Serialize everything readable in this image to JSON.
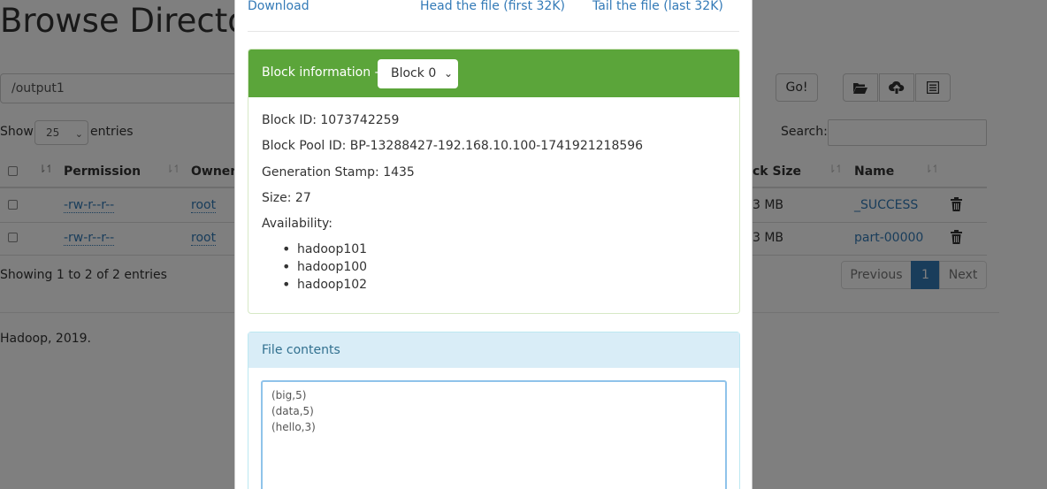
{
  "page": {
    "title": "Browse Directory",
    "path_value": "/output1",
    "go_label": "Go!",
    "show_label": "Show",
    "entries_per_page": "25",
    "entries_label": "entries",
    "search_label": "Search:",
    "columns": [
      "Permission",
      "Owner",
      "ck Size",
      "Name"
    ],
    "rows": [
      {
        "permission": "-rw-r--r--",
        "owner": "root",
        "block_size": "3 MB",
        "name": "_SUCCESS"
      },
      {
        "permission": "-rw-r--r--",
        "owner": "root",
        "block_size": "3 MB",
        "name": "part-00000"
      }
    ],
    "showing_text": "Showing 1 to 2 of 2 entries",
    "pagination": {
      "previous": "Previous",
      "current": "1",
      "next": "Next"
    },
    "footer": "Hadoop, 2019.",
    "icons": [
      "folder-open-icon",
      "cloud-upload-icon",
      "list-icon",
      "trash-icon"
    ]
  },
  "modal": {
    "links": {
      "download": "Download",
      "head": "Head the file (first 32K)",
      "tail": "Tail the file (last 32K)"
    },
    "block_panel": {
      "label": "Block information --",
      "selected_block": "Block 0",
      "block_id": "Block ID: 1073742259",
      "block_pool_id": "Block Pool ID: BP-13288427-192.168.10.100-1741921218596",
      "generation_stamp": "Generation Stamp: 1435",
      "size": "Size: 27",
      "availability_label": "Availability:",
      "availability": [
        "hadoop101",
        "hadoop100",
        "hadoop102"
      ]
    },
    "contents_panel": {
      "label": "File contents",
      "text": "(big,5)\n(data,5)\n(hello,3)"
    }
  },
  "colors": {
    "block_header": "#5ba53a",
    "contents_header": "#d9edf7",
    "link": "#337ab7",
    "active_page": "#337ab7"
  }
}
